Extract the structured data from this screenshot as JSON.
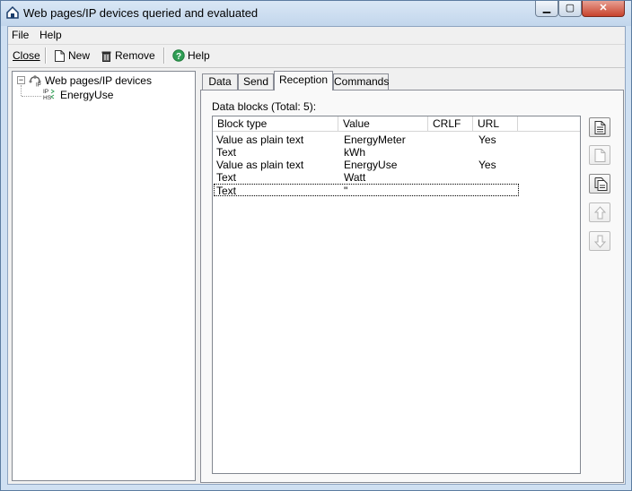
{
  "window": {
    "title": "Web pages/IP devices queried and evaluated",
    "min_glyph": "▁",
    "max_glyph": "▢",
    "close_glyph": "✕"
  },
  "menu": [
    {
      "label": "File"
    },
    {
      "label": "Help"
    }
  ],
  "toolbar": {
    "close_label": "Close",
    "new_label": "New",
    "remove_label": "Remove",
    "help_label": "Help"
  },
  "tree": {
    "root_expander": "−",
    "root_label": "Web pages/IP devices",
    "root_icon_text": "IP",
    "child_label": "EnergyUse",
    "child_icon_text": "IP HS"
  },
  "tabs": [
    {
      "label": "Data"
    },
    {
      "label": "Send"
    },
    {
      "label": "Reception",
      "active": true
    },
    {
      "label": "Commands"
    }
  ],
  "reception": {
    "data_blocks_label": "Data blocks (Total: 5):",
    "columns": [
      "Block type",
      "Value",
      "CRLF",
      "URL"
    ],
    "rows": [
      {
        "type": "Value as plain text",
        "value": "EnergyMeter",
        "crlf": "",
        "url": "Yes"
      },
      {
        "type": "Text",
        "value": "kWh",
        "crlf": "",
        "url": ""
      },
      {
        "type": "Value as plain text",
        "value": "EnergyUse",
        "crlf": "",
        "url": "Yes"
      },
      {
        "type": "Text",
        "value": "Watt",
        "crlf": "",
        "url": ""
      },
      {
        "type": "Text",
        "value": "\"",
        "crlf": "",
        "url": ""
      }
    ],
    "focused_row": 4
  },
  "side_buttons": [
    {
      "icon": "new-document-icon",
      "enabled": true
    },
    {
      "icon": "edit-document-icon",
      "enabled": false
    },
    {
      "icon": "copy-document-icon",
      "enabled": true
    },
    {
      "icon": "arrow-up-icon",
      "enabled": false
    },
    {
      "icon": "arrow-down-icon",
      "enabled": false
    }
  ],
  "colors": {
    "titlebar": "#c2d6ec",
    "close_button": "#c7432d",
    "help_icon": "#1f7a3a"
  }
}
